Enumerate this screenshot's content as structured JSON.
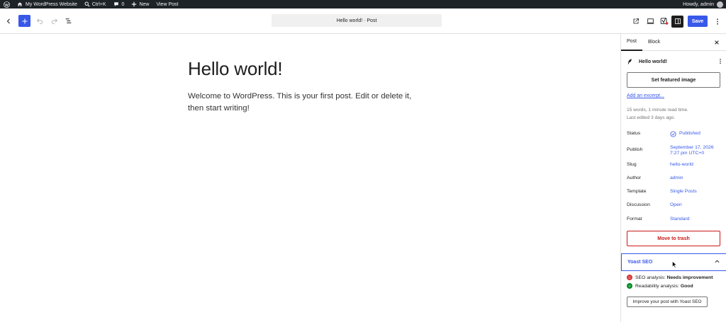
{
  "adminbar": {
    "site_name": "My WordPress Website",
    "search_shortcut": "Ctrl+K",
    "comments_count": "0",
    "new_label": "New",
    "view_post": "View Post",
    "greeting": "Howdy, admin",
    "icons": [
      "wordpress-icon",
      "home-icon",
      "search-icon",
      "comment-icon",
      "plus-icon"
    ]
  },
  "header": {
    "document_title": "Hello world! · Post",
    "save_label": "Save",
    "icons": [
      "chevron-left-icon",
      "plus-icon",
      "undo-icon",
      "redo-icon",
      "list-view-icon",
      "external-link-icon",
      "preview-icon",
      "yoast-icon",
      "sidebar-toggle-icon",
      "more-vertical-icon"
    ]
  },
  "post": {
    "title": "Hello world!",
    "body": "Welcome to WordPress. This is your first post. Edit or delete it, then start writing!"
  },
  "sidebar": {
    "tabs": [
      "Post",
      "Block"
    ],
    "post_title": "Hello world!",
    "featured_image": "Set featured image",
    "excerpt_link": "Add an excerpt...",
    "stats_words": "15 words, 1 minute read time.",
    "stats_edited": "Last edited 3 days ago.",
    "meta": [
      {
        "label": "Status",
        "value": "Published"
      },
      {
        "label": "Publish",
        "value": "September 17, 2026",
        "value2": "7:27 pm UTC+0"
      },
      {
        "label": "Slug",
        "value": "hello-world"
      },
      {
        "label": "Author",
        "value": "admin"
      },
      {
        "label": "Template",
        "value": "Single Posts"
      },
      {
        "label": "Discussion",
        "value": "Open"
      },
      {
        "label": "Format",
        "value": "Standard"
      }
    ],
    "trash": "Move to trash",
    "yoast": {
      "title": "Yoast SEO",
      "seo_label": "SEO analysis: ",
      "seo_value": "Needs improvement",
      "readability_label": "Readability analysis: ",
      "readability_value": "Good",
      "improve_button": "Improve your post with Yoast SEO"
    }
  },
  "colors": {
    "accent": "#3858e9",
    "admin_bar": "#1d2327",
    "danger": "#cc1818",
    "good": "#008a20",
    "bad": "#d63638"
  }
}
